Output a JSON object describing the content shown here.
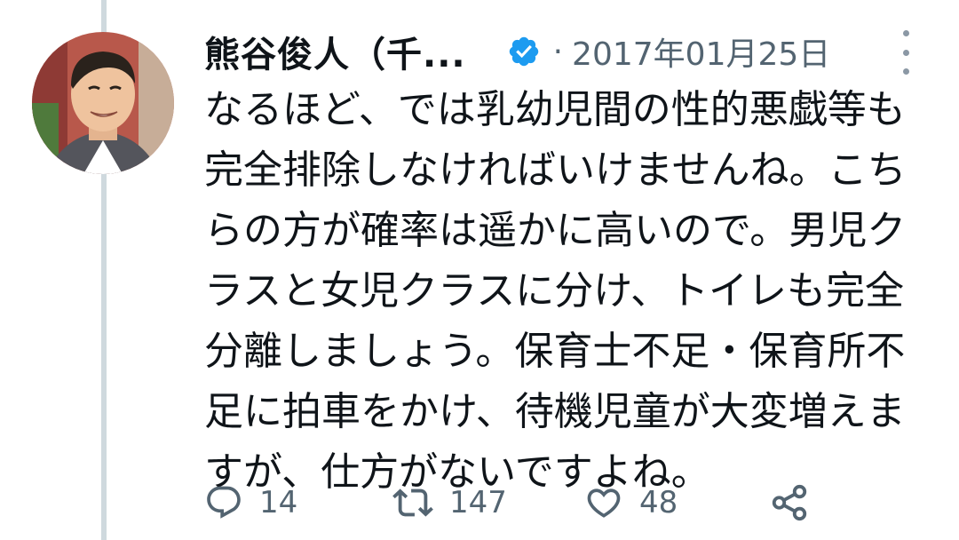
{
  "tweet": {
    "author": {
      "name": "熊谷俊人（千...",
      "verified": true,
      "avatar": "profile-photo"
    },
    "separator": "·",
    "timestamp": "2017年01月25日",
    "text_lines": [
      "なるほど、では乳幼児間の性的悪戯等も",
      "完全排除しなければいけませんね。こち",
      "らの方が確率は遥かに高いので。男児ク",
      "ラスと女児クラスに分け、トイレも完全",
      "分離しましょう。保育士不足・保育所不",
      "足に拍車をかけ、待機児童が大変増えま",
      "すが、仕方がないですよね。"
    ],
    "actions": {
      "reply": {
        "icon": "reply-icon",
        "count": "14"
      },
      "retweet": {
        "icon": "retweet-icon",
        "count": "147"
      },
      "like": {
        "icon": "heart-icon",
        "count": "48"
      },
      "share": {
        "icon": "share-icon"
      }
    }
  },
  "colors": {
    "text": "#0f1419",
    "secondary": "#536471",
    "verified_badge": "#1d9bf0",
    "thread_line": "#cfd9de"
  }
}
